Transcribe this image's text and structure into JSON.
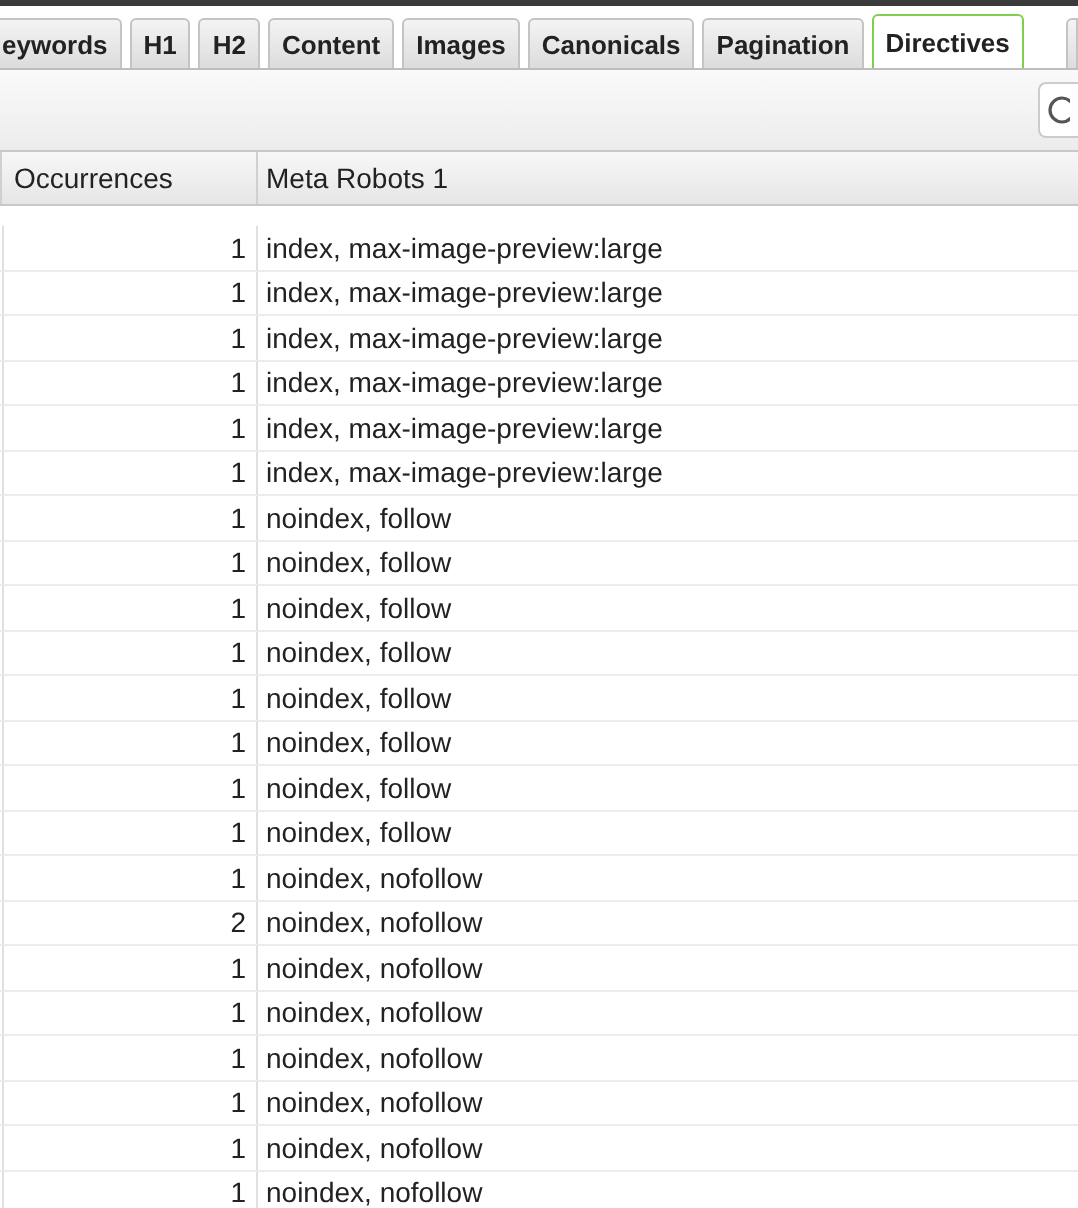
{
  "tabs": [
    {
      "label": "eywords",
      "selected": false
    },
    {
      "label": "H1",
      "selected": false
    },
    {
      "label": "H2",
      "selected": false
    },
    {
      "label": "Content",
      "selected": false
    },
    {
      "label": "Images",
      "selected": false
    },
    {
      "label": "Canonicals",
      "selected": false
    },
    {
      "label": "Pagination",
      "selected": false
    },
    {
      "label": "Directives",
      "selected": true
    }
  ],
  "table": {
    "columns": [
      "Occurrences",
      "Meta Robots 1"
    ],
    "rows": [
      [
        "1",
        "index, max-image-preview:large"
      ],
      [
        "1",
        "index, max-image-preview:large"
      ],
      [
        "1",
        "index, max-image-preview:large"
      ],
      [
        "1",
        "index, max-image-preview:large"
      ],
      [
        "1",
        "index, max-image-preview:large"
      ],
      [
        "1",
        "index, max-image-preview:large"
      ],
      [
        "1",
        "noindex, follow"
      ],
      [
        "1",
        "noindex, follow"
      ],
      [
        "1",
        "noindex, follow"
      ],
      [
        "1",
        "noindex, follow"
      ],
      [
        "1",
        "noindex, follow"
      ],
      [
        "1",
        "noindex, follow"
      ],
      [
        "1",
        "noindex, follow"
      ],
      [
        "1",
        "noindex, follow"
      ],
      [
        "1",
        "noindex, nofollow"
      ],
      [
        "2",
        "noindex, nofollow"
      ],
      [
        "1",
        "noindex, nofollow"
      ],
      [
        "1",
        "noindex, nofollow"
      ],
      [
        "1",
        "noindex, nofollow"
      ],
      [
        "1",
        "noindex, nofollow"
      ],
      [
        "1",
        "noindex, nofollow"
      ],
      [
        "1",
        "noindex, nofollow"
      ]
    ]
  }
}
